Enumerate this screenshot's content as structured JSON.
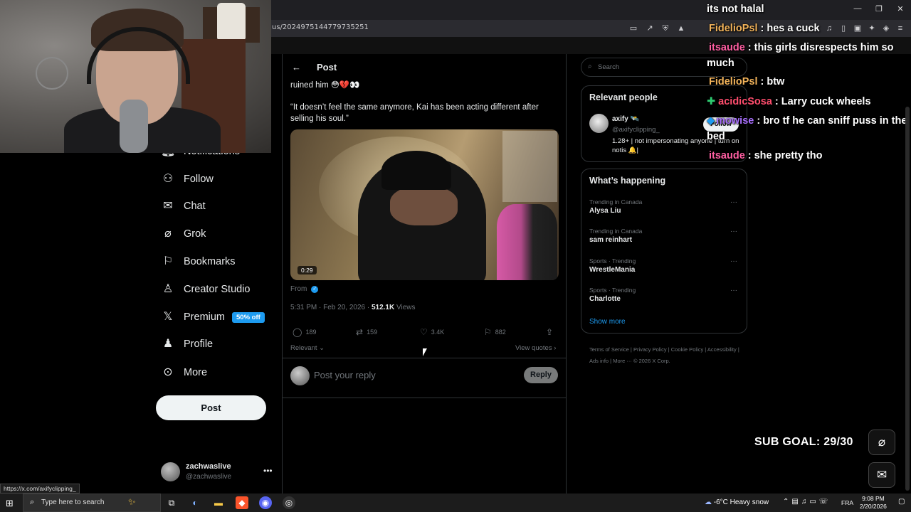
{
  "browser": {
    "url": "us/2024975144779735251",
    "window_controls": [
      "—",
      "❐",
      "✕"
    ]
  },
  "left_nav": {
    "items": [
      {
        "label": "Notifications",
        "icon": "bell-icon"
      },
      {
        "label": "Follow",
        "icon": "person-add-icon"
      },
      {
        "label": "Chat",
        "icon": "mail-icon"
      },
      {
        "label": "Grok",
        "icon": "grok-icon"
      },
      {
        "label": "Bookmarks",
        "icon": "bookmark-icon"
      },
      {
        "label": "Creator Studio",
        "icon": "creator-studio-icon"
      },
      {
        "label": "Premium",
        "icon": "x-logo-icon",
        "badge": "50% off"
      },
      {
        "label": "Profile",
        "icon": "person-icon"
      },
      {
        "label": "More",
        "icon": "more-circle-icon"
      }
    ],
    "post_button": "Post",
    "account": {
      "name": "zachwaslive",
      "handle": "@zachwaslive"
    }
  },
  "status_url": "https://x.com/axifyclipping_",
  "post": {
    "header": "Post",
    "text_line1": "ruined him 😳💔👀",
    "quote": "“It doesn’t feel the same anymore, Kai has been acting different after selling his soul.”",
    "video_duration": "0:29",
    "from_label": "From",
    "timestamp": "5:31 PM · Feb 20, 2026 · ",
    "views_count": "512.1K",
    "views_label": " Views",
    "actions": {
      "replies": "189",
      "reposts": "159",
      "likes": "3.4K",
      "bookmarks": "882"
    },
    "relevant_label": "Relevant",
    "view_quotes_label": "View quotes ›",
    "reply_placeholder": "Post your reply",
    "reply_button": "Reply"
  },
  "right": {
    "search_placeholder": "Search",
    "relevant_people": {
      "title": "Relevant people",
      "name": "axify 🛰️",
      "handle": "@axifyclipping_",
      "bio": "1.28+ | not impersonating anyone | turn on notis 🔔|",
      "follow_label": "Follow"
    },
    "whats_happening": {
      "title": "What’s happening",
      "trends": [
        {
          "context": "Trending in Canada",
          "name": "Alysa Liu"
        },
        {
          "context": "Trending in Canada",
          "name": "sam reinhart"
        },
        {
          "context": "Sports · Trending",
          "name": "WrestleMania"
        },
        {
          "context": "Sports · Trending",
          "name": "Charlotte"
        }
      ],
      "show_more": "Show more"
    },
    "footer": "Terms of Service  |  Privacy Policy  |  Cookie Policy  |  Accessibility  |  Ads info  |  More ···  © 2026 X Corp."
  },
  "chat": [
    {
      "user": "",
      "message": "its not halal",
      "color": "#ffffff"
    },
    {
      "user": "FidelioPsl",
      "message": ": hes a cuck",
      "color": "#f2b35a"
    },
    {
      "user": "itsaude",
      "message": ": this girls disrespects him so",
      "color": "#ff5fa2"
    },
    {
      "user": "",
      "message": "much",
      "color": "#ffffff"
    },
    {
      "user": "FidelioPsl",
      "message": ": btw",
      "color": "#f2b35a"
    },
    {
      "user": "acidicSosa",
      "message": ": Larry cuck wheels",
      "color": "#ff4d6d"
    },
    {
      "user": "mowise",
      "message": ": bro tf he can sniff puss in the",
      "color": "#a970ff"
    },
    {
      "user": "",
      "message": "bed",
      "color": "#ffffff"
    },
    {
      "user": "itsaude",
      "message": ": she pretty tho",
      "color": "#ff5fa2"
    }
  ],
  "sub_goal": "SUB GOAL: 29/30",
  "taskbar": {
    "search_placeholder": "Type here to search",
    "weather": "-6°C  Heavy snow",
    "language": "FRA",
    "time": "9:08 PM",
    "date": "2/20/2026"
  },
  "colors": {
    "accent": "#1d9bf0",
    "background": "#000000",
    "muted": "#71767b"
  }
}
